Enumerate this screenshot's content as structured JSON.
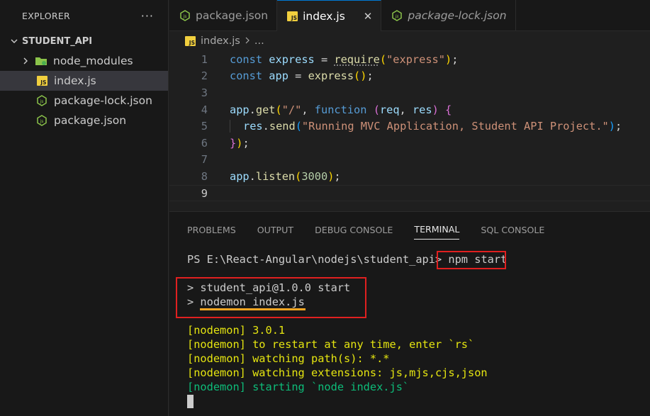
{
  "explorer": {
    "title": "EXPLORER",
    "more": "···",
    "folder": "STUDENT_API",
    "items": [
      {
        "label": "node_modules"
      },
      {
        "label": "index.js"
      },
      {
        "label": "package-lock.json"
      },
      {
        "label": "package.json"
      }
    ]
  },
  "tabs": [
    {
      "label": "package.json"
    },
    {
      "label": "index.js",
      "close": "✕"
    },
    {
      "label": "package-lock.json"
    }
  ],
  "breadcrumb": {
    "file": "index.js",
    "rest": "..."
  },
  "editor": {
    "line_numbers": [
      "1",
      "2",
      "3",
      "4",
      "5",
      "6",
      "7",
      "8",
      "9"
    ],
    "code": {
      "l1": {
        "a": "const",
        "b": "express",
        "c": " = ",
        "d": "require",
        "e": "(",
        "f": "\"express\"",
        "g": ")",
        "h": ";"
      },
      "l2": {
        "a": "const",
        "b": "app",
        "c": " = ",
        "d": "express",
        "e": "(",
        "g": ")",
        "h": ";"
      },
      "l4": {
        "a": "app",
        "b": ".",
        "c": "get",
        "d": "(",
        "e": "\"/\"",
        "f": ", ",
        "g": "function",
        "h": " ",
        "i": "(",
        "j": "req",
        "k": ", ",
        "l": "res",
        "m": ")",
        "n": " ",
        "o": "{"
      },
      "l5": {
        "a": "res",
        "b": ".",
        "c": "send",
        "d": "(",
        "e": "\"Running MVC Application, Student API Project.\"",
        "f": ")",
        "g": ";"
      },
      "l6": {
        "a": "}",
        "b": ")",
        "c": ";"
      },
      "l8": {
        "a": "app",
        "b": ".",
        "c": "listen",
        "d": "(",
        "e": "3000",
        "f": ")",
        "g": ";"
      }
    }
  },
  "panel": {
    "tabs": [
      "PROBLEMS",
      "OUTPUT",
      "DEBUG CONSOLE",
      "TERMINAL",
      "SQL CONSOLE"
    ],
    "terminal": {
      "prompt": "PS E:\\React-Angular\\nodejs\\student_api>",
      "command": "npm start",
      "out1": "> student_api@1.0.0 start",
      "out2_prefix": "> ",
      "out2_cmd": "nodemon index.js",
      "n1": "[nodemon] 3.0.1",
      "n2": "[nodemon] to restart at any time, enter `rs`",
      "n3": "[nodemon] watching path(s): *.*",
      "n4": "[nodemon] watching extensions: js,mjs,cjs,json",
      "n5": "[nodemon] starting `node index.js`"
    }
  }
}
